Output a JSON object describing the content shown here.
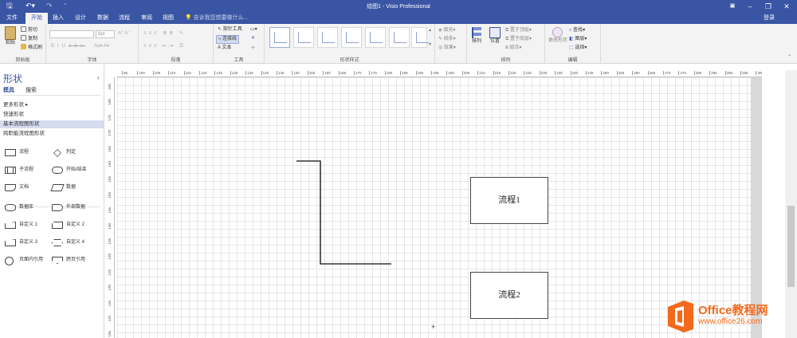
{
  "title": "绘图1 - Visio Professional",
  "menu": {
    "file": "文件",
    "start": "开始",
    "insert": "插入",
    "design": "设计",
    "data": "数据",
    "process": "流程",
    "review": "审阅",
    "view": "视图",
    "tell_me": "告诉我您想要做什么...",
    "login": "登录"
  },
  "ribbon": {
    "clipboard": {
      "label": "剪贴板",
      "paste": "粘贴",
      "cut": "剪切",
      "copy": "复制",
      "format_painter": "格式刷"
    },
    "font": {
      "label": "字体",
      "size": "8pt"
    },
    "paragraph": {
      "label": "段落"
    },
    "tools": {
      "label": "工具",
      "pointer": "指针工具",
      "connector": "连接线",
      "text": "文本"
    },
    "shape_styles": {
      "label": "形状样式",
      "fill": "填充",
      "line": "线条",
      "effect": "效果"
    },
    "arrange": {
      "label": "排列",
      "align": "排列",
      "position": "位置",
      "bring_front": "置于顶层",
      "send_back": "置于底层",
      "group": "组合"
    },
    "edit": {
      "label": "编辑",
      "change_shape": "更改形状",
      "find": "查找",
      "layer": "图层",
      "select": "选择"
    }
  },
  "shapes_pane": {
    "title": "形状",
    "tab_stencils": "模具",
    "tab_search": "搜索",
    "more_shapes": "更多形状",
    "quick_shapes": "快速形状",
    "basic_flowchart": "基本流程图形状",
    "cross_functional": "跨职能流程图形状",
    "shapes": [
      {
        "label": "流程"
      },
      {
        "label": "判定"
      },
      {
        "label": "子流程"
      },
      {
        "label": "开始/结束"
      },
      {
        "label": "文档"
      },
      {
        "label": "数据"
      },
      {
        "label": "数据库"
      },
      {
        "label": "外部数据"
      },
      {
        "label": "自定义 1"
      },
      {
        "label": "自定义 2"
      },
      {
        "label": "自定义 3"
      },
      {
        "label": "自定义 4"
      },
      {
        "label": "页面内引用"
      },
      {
        "label": "跨页引用"
      }
    ]
  },
  "rulers": {
    "h_ticks": [
      "95",
      "100",
      "105",
      "110",
      "115",
      "120",
      "125",
      "130",
      "135",
      "140",
      "145",
      "150",
      "155",
      "160",
      "165",
      "170",
      "175",
      "180",
      "185",
      "190",
      "195",
      "200",
      "205",
      "210",
      "215",
      "220",
      "225",
      "230",
      "235",
      "240",
      "245",
      "250",
      "255",
      "260",
      "265",
      "270",
      "275",
      "280",
      "285",
      "290",
      "295",
      "300"
    ],
    "v_ticks": [
      "185",
      "180",
      "175",
      "170",
      "165",
      "160",
      "155",
      "150",
      "145",
      "140",
      "135",
      "130",
      "125",
      "120",
      "115",
      "110",
      "105"
    ]
  },
  "canvas": {
    "process1": "流程1",
    "process2": "流程2"
  },
  "watermark": {
    "brand": "Office教程网",
    "url": "www.office26.com",
    "colors": {
      "brand": "#f26a1b",
      "accent": "#3955a3"
    }
  }
}
